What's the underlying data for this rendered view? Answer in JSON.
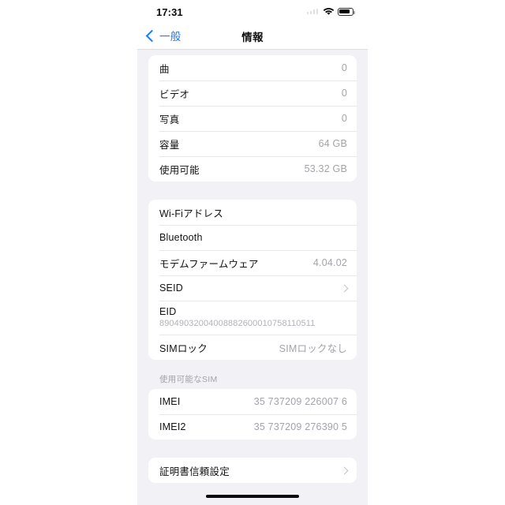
{
  "status_bar": {
    "time": "17:31",
    "signal_icon": "cellular-dots-icon",
    "wifi_icon": "wifi-icon",
    "battery_icon": "battery-icon"
  },
  "nav_bar": {
    "back_label": "一般",
    "back_icon": "chevron-left-icon",
    "title": "情報"
  },
  "sections": {
    "storage": {
      "rows": [
        {
          "label": "曲",
          "value": "0"
        },
        {
          "label": "ビデオ",
          "value": "0"
        },
        {
          "label": "写真",
          "value": "0"
        },
        {
          "label": "容量",
          "value": "64 GB"
        },
        {
          "label": "使用可能",
          "value": "53.32 GB"
        }
      ]
    },
    "network": {
      "rows": [
        {
          "label": "Wi-Fiアドレス",
          "value": ""
        },
        {
          "label": "Bluetooth",
          "value": ""
        },
        {
          "label": "モデムファームウェア",
          "value": "4.04.02"
        },
        {
          "label": "SEID",
          "value": ""
        },
        {
          "label": "EID",
          "value": "89049032004008882600010758110511"
        },
        {
          "label": "SIMロック",
          "value": "SIMロックなし"
        }
      ]
    },
    "sim": {
      "header": "使用可能なSIM",
      "rows": [
        {
          "label": "IMEI",
          "value": "35 737209 226007 6"
        },
        {
          "label": "IMEI2",
          "value": "35 737209 276390 5"
        }
      ]
    },
    "certificates": {
      "rows": [
        {
          "label": "証明書信頼設定",
          "value": ""
        }
      ]
    }
  },
  "colors": {
    "accent": "#1a7afc",
    "background": "#f1f1f6",
    "card": "#ffffff",
    "value_text": "#a3a3a9",
    "label_text": "#121214"
  }
}
